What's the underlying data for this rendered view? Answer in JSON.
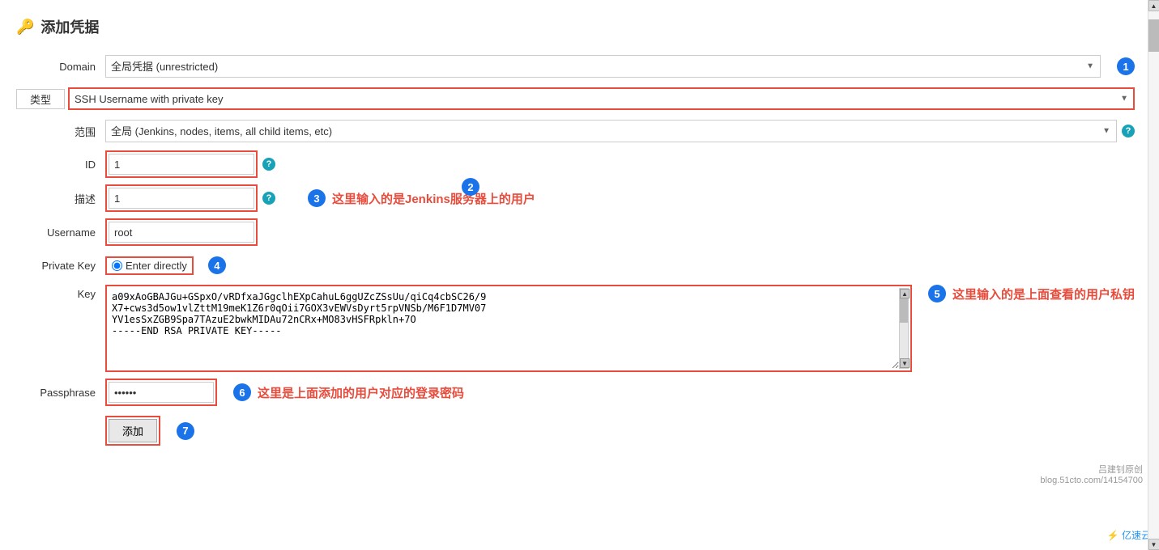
{
  "page": {
    "title": "添加凭据",
    "title_icon": "🔑"
  },
  "form": {
    "domain_label": "Domain",
    "domain_value": "全局凭据 (unrestricted)",
    "type_label": "类型",
    "type_value": "SSH Username with private key",
    "scope_label": "范围",
    "scope_value": "全局 (Jenkins, nodes, items, all child items, etc)",
    "id_label": "ID",
    "id_value": "1",
    "description_label": "描述",
    "description_value": "1",
    "username_label": "Username",
    "username_value": "root",
    "private_key_label": "Private Key",
    "enter_directly_label": "Enter directly",
    "key_label": "Key",
    "key_value": "a09xAoGBAJGu+GSpxO/vRDfxaJGgclhEXpCahuL6ggUZcZSsUu/qiCq4cbSC26/9\nX7+cws3d5ow1vlZttM19meK1Z6r0qOii7GOX3vEWVsDyrt5rpVNSb/M6F1D7MV07\nYV1esSxZGB9Spa7TAzuE2bwkMIDAu72nCRx+MO83vHSFRpkln+7O\n-----END RSA PRIVATE KEY-----",
    "passphrase_label": "Passphrase",
    "passphrase_value": "••••••",
    "add_button_label": "添加"
  },
  "annotations": {
    "ann1_num": "1",
    "ann2_num": "2",
    "ann3_num": "3",
    "ann3_text": "这里输入的是Jenkins服务器上的用户",
    "ann4_num": "4",
    "ann5_num": "5",
    "ann5_text": "这里输入的是上面查看的用户私钥",
    "ann6_num": "6",
    "ann6_text": "这里是上面添加的用户对应的登录密码",
    "ann7_num": "7"
  },
  "watermark": {
    "line1": "吕建钊原创",
    "line2": "blog.51cto.com/14154700"
  },
  "footer": {
    "logo": "⚡ 亿速云"
  }
}
